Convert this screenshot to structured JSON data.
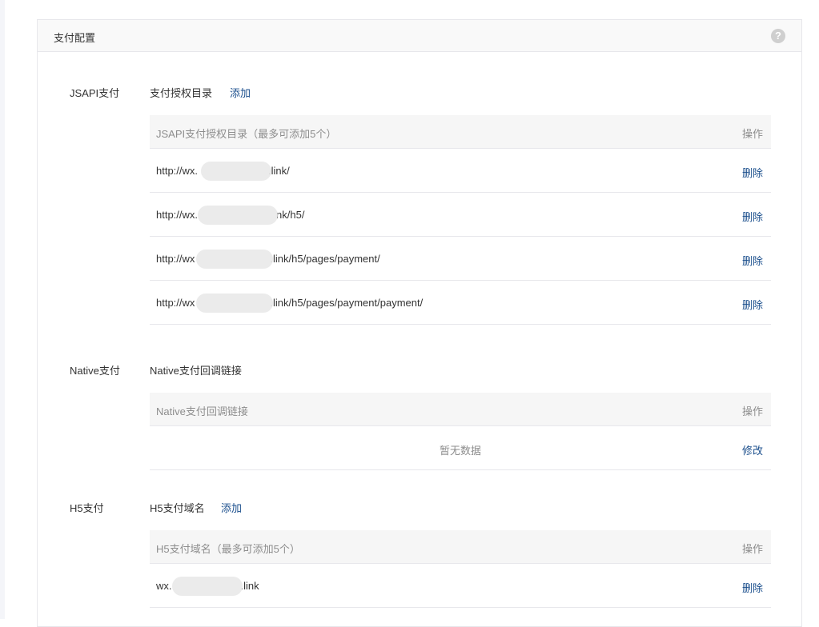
{
  "panel": {
    "title": "支付配置"
  },
  "jsapi": {
    "label": "JSAPI支付",
    "sub_label": "支付授权目录",
    "add": "添加",
    "header_col1": "JSAPI支付授权目录（最多可添加5个）",
    "header_col2": "操作",
    "rows": [
      {
        "prefix": "http://wx.",
        "suffix": ".link/",
        "action": "删除"
      },
      {
        "prefix": "http://wx.",
        "suffix": "nk/h5/",
        "action": "删除"
      },
      {
        "prefix": "http://wx",
        "suffix": ".link/h5/pages/payment/",
        "action": "删除"
      },
      {
        "prefix": "http://wx",
        "suffix": ".link/h5/pages/payment/payment/",
        "action": "删除"
      }
    ]
  },
  "native": {
    "label": "Native支付",
    "sub_label": "Native支付回调链接",
    "header_col1": "Native支付回调链接",
    "header_col2": "操作",
    "empty": "暂无数据",
    "action": "修改"
  },
  "h5": {
    "label": "H5支付",
    "sub_label": "H5支付域名",
    "add": "添加",
    "header_col1": "H5支付域名（最多可添加5个）",
    "header_col2": "操作",
    "rows": [
      {
        "prefix": "wx.",
        "suffix": ".link",
        "action": "删除"
      }
    ]
  }
}
